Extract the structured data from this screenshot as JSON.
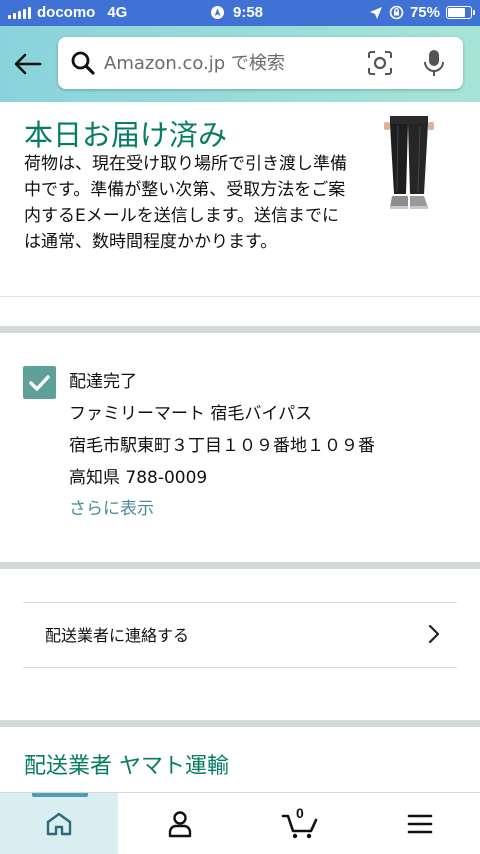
{
  "status_bar": {
    "carrier": "docomo",
    "network": "4G",
    "time": "9:58",
    "battery": "75%",
    "battery_level": 0.75
  },
  "header": {
    "search_placeholder": "Amazon.co.jp で検索"
  },
  "delivery": {
    "title": "本日お届け済み",
    "description": "荷物は、現在受け取り場所で引き渡し準備中です。準備が整い次第、受取方法をご案内するEメールを送信します。送信までには通常、数時間程度かかります。"
  },
  "address": {
    "status": "配達完了",
    "lines": [
      "ファミリーマート 宿毛バイパス",
      "宿毛市駅東町３丁目１０９番地１０９番",
      "高知県 788-0009"
    ],
    "show_more": "さらに表示"
  },
  "contact": {
    "label": "配送業者に連絡する"
  },
  "carrier": {
    "label": "配送業者 ヤマト運輸"
  },
  "bottom_nav": {
    "cart_count": "0"
  },
  "colors": {
    "status_bar": "#3f72d4",
    "header_gradient_start": "#8ad3dc",
    "header_gradient_end": "#a6e4d6",
    "accent_green": "#067d62",
    "link_teal": "#4a8a9a",
    "checkbox": "#5fa09a"
  }
}
